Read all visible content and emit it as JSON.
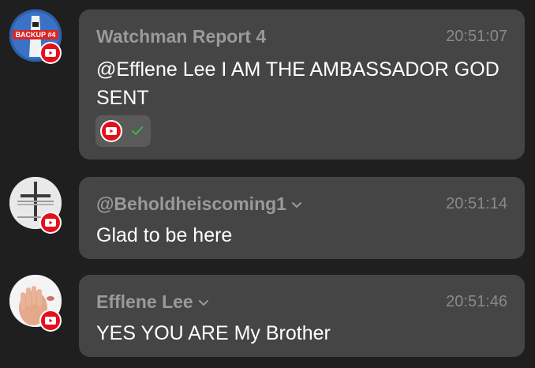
{
  "messages": [
    {
      "author": "Watchman Report 4",
      "time": "20:51:07",
      "text": "@Efflene Lee I AM THE AMBASSADOR GOD SENT",
      "avatar_label": "BACKUP #4",
      "has_chevron": false,
      "has_source_chip": true,
      "icons": [
        "youtube-icon",
        "check-icon"
      ]
    },
    {
      "author": "@Beholdheiscoming1",
      "time": "20:51:14",
      "text": "Glad to be here",
      "has_chevron": true,
      "icons": [
        "youtube-icon",
        "chevron-down-icon"
      ]
    },
    {
      "author": "Efflene Lee",
      "time": "20:51:46",
      "text": "YES YOU ARE My Brother",
      "has_chevron": true,
      "icons": [
        "youtube-icon",
        "chevron-down-icon"
      ]
    }
  ],
  "colors": {
    "background": "#1f1f1f",
    "bubble": "#454545",
    "author": "#9a9a9a",
    "text": "#ffffff",
    "youtube_red": "#e3101b",
    "check_green": "#3bb54a"
  }
}
